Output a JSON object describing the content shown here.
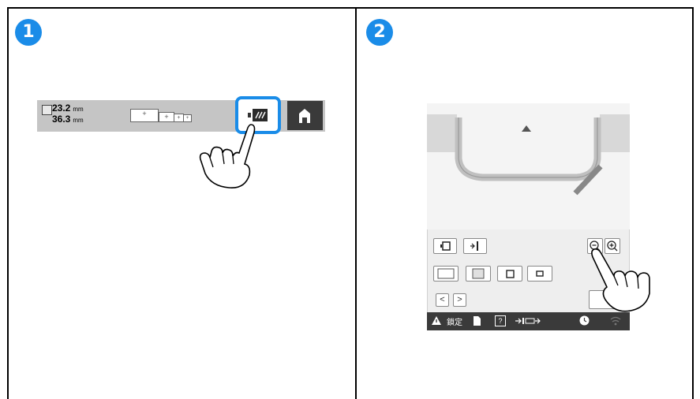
{
  "steps": [
    {
      "number": "1"
    },
    {
      "number": "2"
    }
  ],
  "panel1": {
    "size_width": "23.2",
    "size_height": "36.3",
    "unit": "mm",
    "frame_icons": [
      "+",
      "+",
      "+",
      "+"
    ],
    "camera_icon": "camera-icon",
    "home_icon": "home-icon",
    "highlight_color": "#1a8ce8"
  },
  "panel2": {
    "status_label": "鎖定",
    "help_icon": "?",
    "nav_prev": "<",
    "nav_next": ">"
  }
}
